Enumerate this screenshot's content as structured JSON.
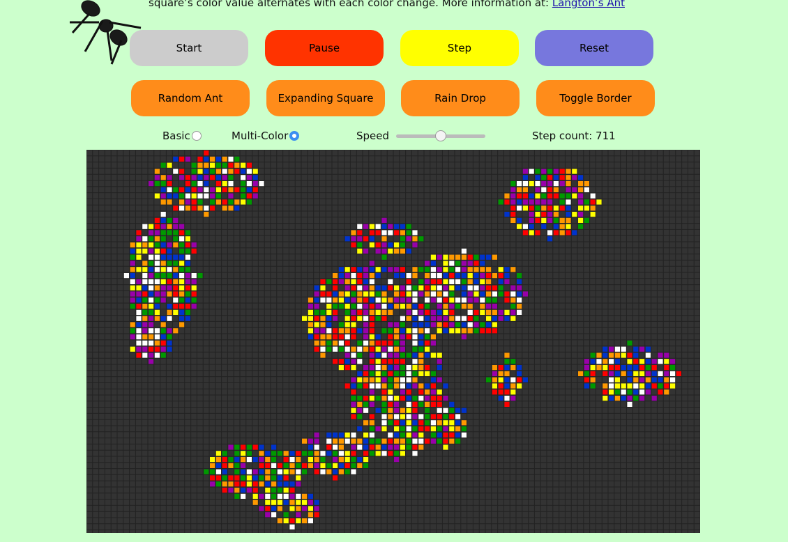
{
  "intro": {
    "text": "square’s color value alternates with each color change. More information at: ",
    "link_label": "Langton’s Ant"
  },
  "controls": {
    "start": "Start",
    "pause": "Pause",
    "step": "Step",
    "reset": "Reset",
    "random_ant": "Random Ant",
    "expanding_square": "Expanding Square",
    "rain_drop": "Rain Drop",
    "toggle_border": "Toggle Border"
  },
  "mode": {
    "basic_label": "Basic",
    "multicolor_label": "Multi-Color",
    "selected": "Multi-Color"
  },
  "speed": {
    "label": "Speed",
    "value_fraction": 0.5
  },
  "step_count": {
    "text": "Step count: 711"
  },
  "colors": {
    "background": "#ccffcc",
    "start": "#cccccc",
    "pause": "#ff3300",
    "step": "#ffff00",
    "reset": "#7777dd",
    "preset": "#ff8c1a",
    "board_bg": "#333333",
    "cell_palette": [
      "#ff0000",
      "#ff9900",
      "#ffff00",
      "#009900",
      "#0033cc",
      "#9900aa",
      "#ffffff"
    ]
  }
}
